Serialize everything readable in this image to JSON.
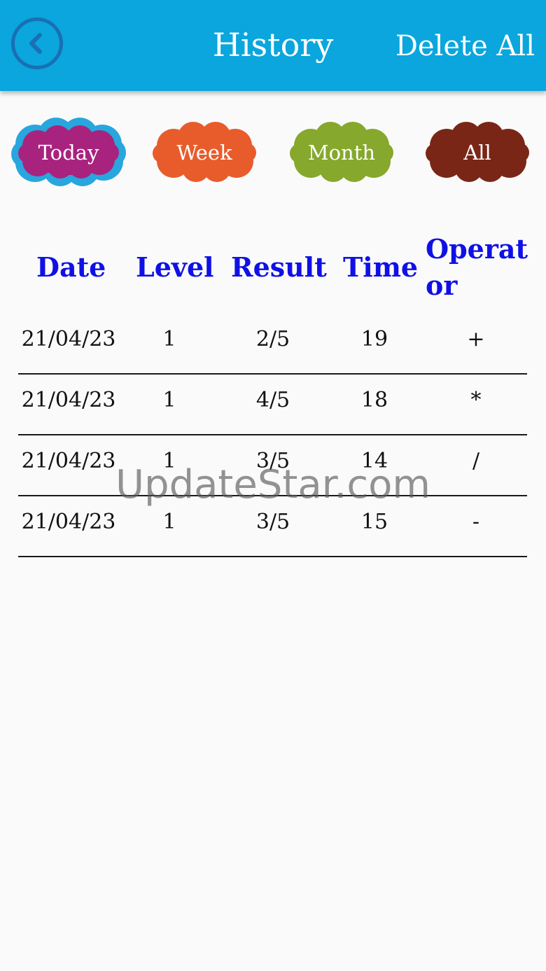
{
  "header": {
    "title": "History",
    "delete_all": "Delete All",
    "back_icon": "chevron-left-icon",
    "bg_color": "#0aa6dd"
  },
  "filters": [
    {
      "label": "Today",
      "color": "#a8237e",
      "selected": true,
      "selected_outline": "#28a6de"
    },
    {
      "label": "Week",
      "color": "#e85c2c",
      "selected": false
    },
    {
      "label": "Month",
      "color": "#86a82c",
      "selected": false
    },
    {
      "label": "All",
      "color": "#7a2616",
      "selected": false
    }
  ],
  "table": {
    "header_color": "#1010e6",
    "columns": [
      "Date",
      "Level",
      "Result",
      "Time",
      "Operat",
      "or"
    ],
    "rows": [
      {
        "date": "21/04/23",
        "level": "1",
        "result": "2/5",
        "time": "19",
        "operator": "+"
      },
      {
        "date": "21/04/23",
        "level": "1",
        "result": "4/5",
        "time": "18",
        "operator": "*"
      },
      {
        "date": "21/04/23",
        "level": "1",
        "result": "3/5",
        "time": "14",
        "operator": "/"
      },
      {
        "date": "21/04/23",
        "level": "1",
        "result": "3/5",
        "time": "15",
        "operator": "-"
      }
    ]
  },
  "watermark": "UpdateStar.com"
}
